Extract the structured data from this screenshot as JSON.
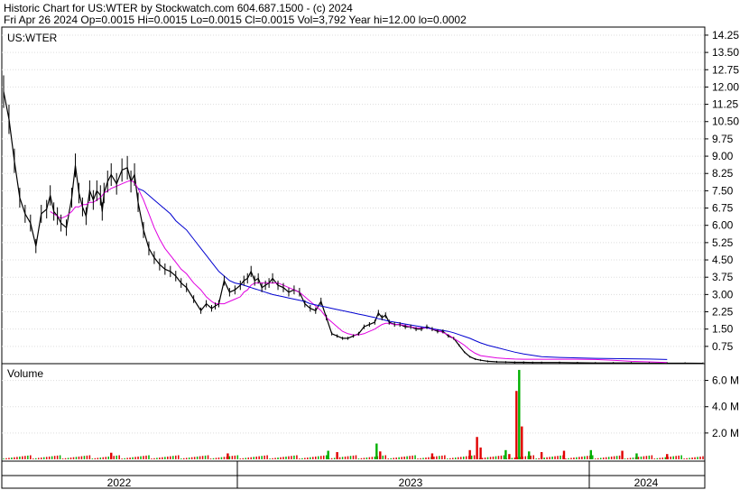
{
  "header": {
    "line1": "Historic Chart for US:WTER by Stockwatch.com 604.687.1500 - (c) 2024",
    "line2": "Fri Apr 26 2024   Op=0.0015   Hi=0.0015   Lo=0.0015   Cl=0.0015   Vol=3,792   Year hi=12.00   lo=0.0002"
  },
  "chart_data": [
    {
      "type": "line",
      "label": "US:WTER",
      "ylim": [
        0,
        14.6
      ],
      "y_ticks": [
        "14.25",
        "13.50",
        "12.75",
        "12.00",
        "11.25",
        "10.50",
        "9.75",
        "9.00",
        "8.25",
        "7.50",
        "6.75",
        "6.00",
        "5.25",
        "4.50",
        "3.75",
        "3.00",
        "2.25",
        "1.50",
        "0.75"
      ],
      "x": [
        0,
        6,
        12,
        18,
        24,
        30,
        36,
        42,
        48,
        52,
        56,
        60,
        64,
        70,
        76,
        80,
        84,
        88,
        92,
        96,
        100,
        104,
        108,
        110,
        112,
        116,
        120,
        126,
        132,
        138,
        142,
        146,
        150,
        156,
        162,
        168,
        174,
        180,
        186,
        192,
        198,
        204,
        212,
        220,
        226,
        232,
        236,
        240,
        246,
        252,
        258,
        264,
        268,
        272,
        276,
        280,
        284,
        288,
        292,
        296,
        300,
        306,
        312,
        318,
        324,
        330,
        336,
        342,
        348,
        354,
        360,
        366,
        372,
        378,
        384,
        390,
        396,
        402,
        408,
        414,
        418,
        422,
        426,
        430,
        436,
        442,
        448,
        454,
        460,
        466,
        472,
        478,
        484,
        490,
        496,
        502,
        508,
        514,
        520,
        526,
        532,
        540,
        550,
        560,
        570,
        580,
        590,
        600,
        620,
        640,
        660,
        680,
        700,
        720,
        740,
        760,
        780
      ],
      "series": [
        {
          "values": [
            11.8,
            10.6,
            8.8,
            7.2,
            6.5,
            6.1,
            5.1,
            6.5,
            6.7,
            7.3,
            6.6,
            6.4,
            6.1,
            5.9,
            7.2,
            8.6,
            7.4,
            6.8,
            6.4,
            7.5,
            7.1,
            7.5,
            7.3,
            6.6,
            7.4,
            7.9,
            8.2,
            7.8,
            8.4,
            8.5,
            7.9,
            8.2,
            7.0,
            5.8,
            5.0,
            4.6,
            4.3,
            4.1,
            4.0,
            3.8,
            3.5,
            3.3,
            2.8,
            2.3,
            2.6,
            2.4,
            2.5,
            2.6,
            3.6,
            3.1,
            3.2,
            3.4,
            3.6,
            3.7,
            4.0,
            3.6,
            3.7,
            3.3,
            3.4,
            3.5,
            3.7,
            3.4,
            3.3,
            3.1,
            3.2,
            3.1,
            2.6,
            2.4,
            2.3,
            2.7,
            2.0,
            1.3,
            1.2,
            1.1,
            1.1,
            1.2,
            1.3,
            1.6,
            1.7,
            1.8,
            2.2,
            2.0,
            2.1,
            1.8,
            1.7,
            1.7,
            1.6,
            1.6,
            1.5,
            1.5,
            1.6,
            1.5,
            1.4,
            1.4,
            1.2,
            1.1,
            0.8,
            0.5,
            0.3,
            0.2,
            0.15,
            0.1,
            0.08,
            0.07,
            0.06,
            0.06,
            0.05,
            0.05,
            0.05,
            0.04,
            0.03,
            0.03,
            0.03,
            0.02,
            0.02,
            0.02,
            0.015
          ],
          "color": "#000000"
        },
        {
          "values": [
            null,
            null,
            null,
            null,
            null,
            null,
            null,
            null,
            null,
            6.6,
            6.5,
            6.4,
            6.3,
            6.4,
            6.6,
            6.8,
            6.8,
            6.9,
            6.9,
            7.0,
            7.0,
            7.1,
            7.2,
            7.3,
            7.4,
            7.5,
            7.6,
            7.7,
            7.8,
            7.9,
            7.95,
            7.85,
            7.6,
            7.1,
            6.5,
            5.9,
            5.4,
            5.0,
            4.7,
            4.4,
            4.1,
            3.9,
            3.5,
            3.2,
            2.9,
            2.7,
            2.6,
            2.6,
            2.6,
            2.7,
            2.8,
            2.9,
            3.1,
            3.2,
            3.4,
            3.5,
            3.5,
            3.5,
            3.5,
            3.5,
            3.5,
            3.5,
            3.4,
            3.3,
            3.2,
            3.1,
            2.9,
            2.7,
            2.5,
            2.3,
            2.0,
            1.8,
            1.6,
            1.4,
            1.3,
            1.25,
            1.25,
            1.3,
            1.4,
            1.5,
            1.6,
            1.7,
            1.75,
            1.75,
            1.7,
            1.7,
            1.65,
            1.6,
            1.55,
            1.55,
            1.55,
            1.5,
            1.45,
            1.35,
            1.25,
            1.1,
            0.95,
            0.8,
            0.6,
            0.45,
            0.35,
            0.3,
            0.25,
            0.22,
            0.2,
            0.19,
            0.19,
            0.19,
            0.19,
            0.19,
            0.18,
            0.15,
            0.1,
            0.08,
            0.05
          ],
          "color": "#e000e0"
        },
        {
          "values": [
            null,
            null,
            null,
            null,
            null,
            null,
            null,
            null,
            null,
            null,
            null,
            null,
            null,
            null,
            null,
            null,
            null,
            null,
            null,
            null,
            null,
            null,
            null,
            null,
            null,
            null,
            null,
            null,
            null,
            null,
            null,
            null,
            7.6,
            7.5,
            7.3,
            7.1,
            6.9,
            6.7,
            6.5,
            6.2,
            6.0,
            5.8,
            5.4,
            5.0,
            4.7,
            4.4,
            4.2,
            4.0,
            3.8,
            3.6,
            3.5,
            3.45,
            3.4,
            3.35,
            3.3,
            3.25,
            3.2,
            3.15,
            3.1,
            3.05,
            3.0,
            2.95,
            2.9,
            2.85,
            2.8,
            2.75,
            2.7,
            2.6,
            2.55,
            2.5,
            2.45,
            2.4,
            2.35,
            2.3,
            2.25,
            2.2,
            2.15,
            2.1,
            2.05,
            2.0,
            1.95,
            1.92,
            1.88,
            1.84,
            1.8,
            1.76,
            1.72,
            1.68,
            1.64,
            1.6,
            1.56,
            1.52,
            1.48,
            1.44,
            1.4,
            1.34,
            1.26,
            1.18,
            1.1,
            1.0,
            0.9,
            0.8,
            0.7,
            0.6,
            0.5,
            0.42,
            0.36,
            0.3,
            0.27,
            0.25,
            0.23,
            0.22,
            0.21,
            0.2,
            0.18
          ],
          "color": "#0000d0"
        }
      ]
    },
    {
      "type": "bar",
      "label": "Volume",
      "ylim": [
        0,
        7000000
      ],
      "y_ticks": [
        "6.0 M",
        "4.0 M",
        "2.0 M"
      ],
      "y_tick_values": [
        6000000,
        4000000,
        2000000
      ],
      "bars": [
        {
          "x": 120,
          "v": 500000,
          "c": "#e00000"
        },
        {
          "x": 250,
          "v": 450000,
          "c": "#e00000"
        },
        {
          "x": 362,
          "v": 650000,
          "c": "#00b000"
        },
        {
          "x": 372,
          "v": 550000,
          "c": "#e00000"
        },
        {
          "x": 416,
          "v": 1200000,
          "c": "#00b000"
        },
        {
          "x": 420,
          "v": 600000,
          "c": "#e00000"
        },
        {
          "x": 478,
          "v": 450000,
          "c": "#e00000"
        },
        {
          "x": 520,
          "v": 700000,
          "c": "#e00000"
        },
        {
          "x": 528,
          "v": 1700000,
          "c": "#e00000"
        },
        {
          "x": 532,
          "v": 900000,
          "c": "#e00000"
        },
        {
          "x": 560,
          "v": 700000,
          "c": "#00b000"
        },
        {
          "x": 564,
          "v": 400000,
          "c": "#e00000"
        },
        {
          "x": 572,
          "v": 5200000,
          "c": "#e00000"
        },
        {
          "x": 575,
          "v": 6800000,
          "c": "#00b000"
        },
        {
          "x": 578,
          "v": 2500000,
          "c": "#e00000"
        },
        {
          "x": 586,
          "v": 600000,
          "c": "#00b000"
        },
        {
          "x": 600,
          "v": 550000,
          "c": "#e00000"
        },
        {
          "x": 625,
          "v": 650000,
          "c": "#e00000"
        },
        {
          "x": 655,
          "v": 700000,
          "c": "#00b000"
        },
        {
          "x": 690,
          "v": 650000,
          "c": "#e00000"
        },
        {
          "x": 706,
          "v": 450000,
          "c": "#00b000"
        },
        {
          "x": 740,
          "v": 400000,
          "c": "#e00000"
        }
      ]
    }
  ],
  "x_axis": {
    "labels": [
      "2022",
      "2023",
      "2024"
    ],
    "label_x": [
      132,
      455,
      716
    ],
    "dividers_x": [
      263,
      653
    ]
  }
}
